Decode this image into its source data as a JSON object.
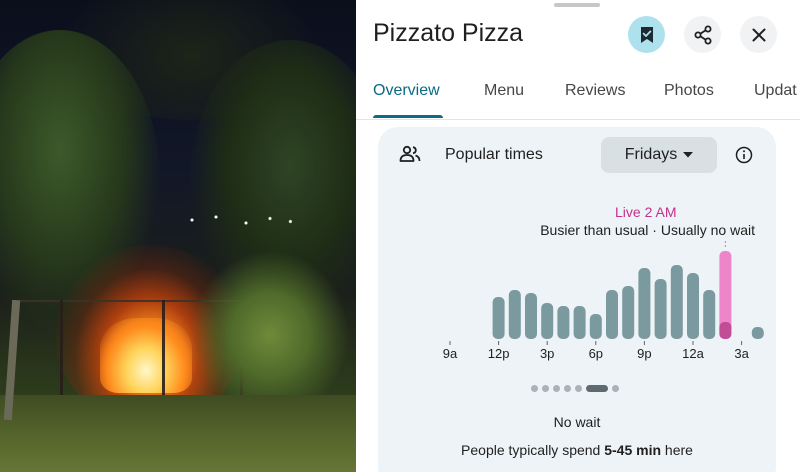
{
  "place": {
    "name": "Pizzato Pizza"
  },
  "header_buttons": {
    "save_icon": "bookmark-icon",
    "share_icon": "share-icon",
    "close_icon": "close-icon"
  },
  "tabs": [
    {
      "label": "Overview",
      "active": true
    },
    {
      "label": "Menu",
      "active": false
    },
    {
      "label": "Reviews",
      "active": false
    },
    {
      "label": "Photos",
      "active": false
    },
    {
      "label": "Updat",
      "active": false
    }
  ],
  "popular_times": {
    "label": "Popular times",
    "day": "Fridays",
    "live_label": "Live 2 AM",
    "status": "Busier than usual · Usually no wait",
    "wait_text": "No wait",
    "spend_prefix": "People typically spend ",
    "spend_value": "5-45 min",
    "spend_suffix": " here",
    "page_count": 7,
    "active_page": 5
  },
  "chart_data": {
    "type": "bar",
    "hours": [
      "9a",
      "10a",
      "11a",
      "12p",
      "1p",
      "2p",
      "3p",
      "4p",
      "5p",
      "6p",
      "7p",
      "8p",
      "9p",
      "10p",
      "11p",
      "12a",
      "1a",
      "2a",
      "3a"
    ],
    "usual": [
      0,
      0,
      0,
      42,
      49,
      46,
      36,
      33,
      33,
      25,
      49,
      53,
      71,
      60,
      74,
      66,
      49,
      26,
      0,
      12
    ],
    "tick_labels": [
      "9a",
      "12p",
      "3p",
      "6p",
      "9p",
      "12a",
      "3a"
    ],
    "live_hour": "2a",
    "live_usual": 17,
    "live_value": 88,
    "colors": {
      "bar": "#7a9a9f",
      "live_fill": "#ec86c8",
      "live_base": "#c24d97"
    }
  }
}
